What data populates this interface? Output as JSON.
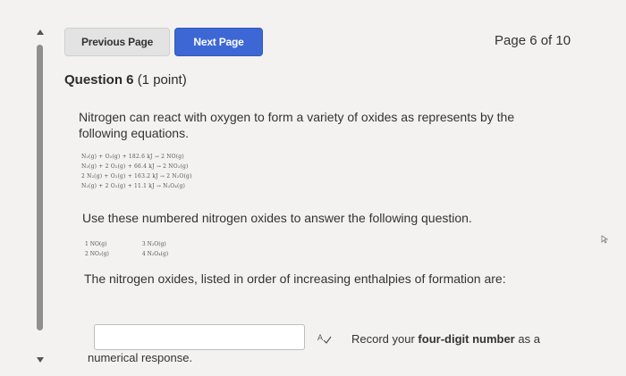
{
  "nav": {
    "previous_label": "Previous Page",
    "next_label": "Next Page",
    "page_indicator": "Page 6 of 10"
  },
  "question": {
    "title": "Question 6",
    "points": "(1 point)",
    "prompt": "Nitrogen can react with oxygen to form a variety of oxides as represents by the following equations.",
    "equations": [
      "N₂(g) + O₂(g) + 182.6 kJ → 2 NO(g)",
      "N₂(g) + 2 O₂(g) + 66.4 kJ → 2 NO₂(g)",
      "2 N₂(g) + O₂(g) + 163.2 kJ → 2 N₂O(g)",
      "N₂(g) + 2 O₂(g) + 11.1 kJ → N₂O₄(g)"
    ],
    "instruction": "Use these numbered nitrogen oxides to answer the following question.",
    "oxides": [
      "1  NO(g)",
      "2  NO₂(g)",
      "3  N₂O(g)",
      "4  N₂O₄(g)"
    ],
    "statement": "The nitrogen oxides, listed in order of increasing enthalpies of formation are:"
  },
  "answer": {
    "value": "",
    "hint_prefix": "Record your ",
    "hint_bold": "four-digit number",
    "hint_suffix": " as a",
    "hint_continuation": "numerical response."
  },
  "icons": {
    "spellcheck": "spellcheck-icon",
    "cursor": "pointer-cursor-icon"
  },
  "colors": {
    "background": "#f3f2f0",
    "next_button": "#3d67d4",
    "previous_button": "#e3e3e3"
  }
}
